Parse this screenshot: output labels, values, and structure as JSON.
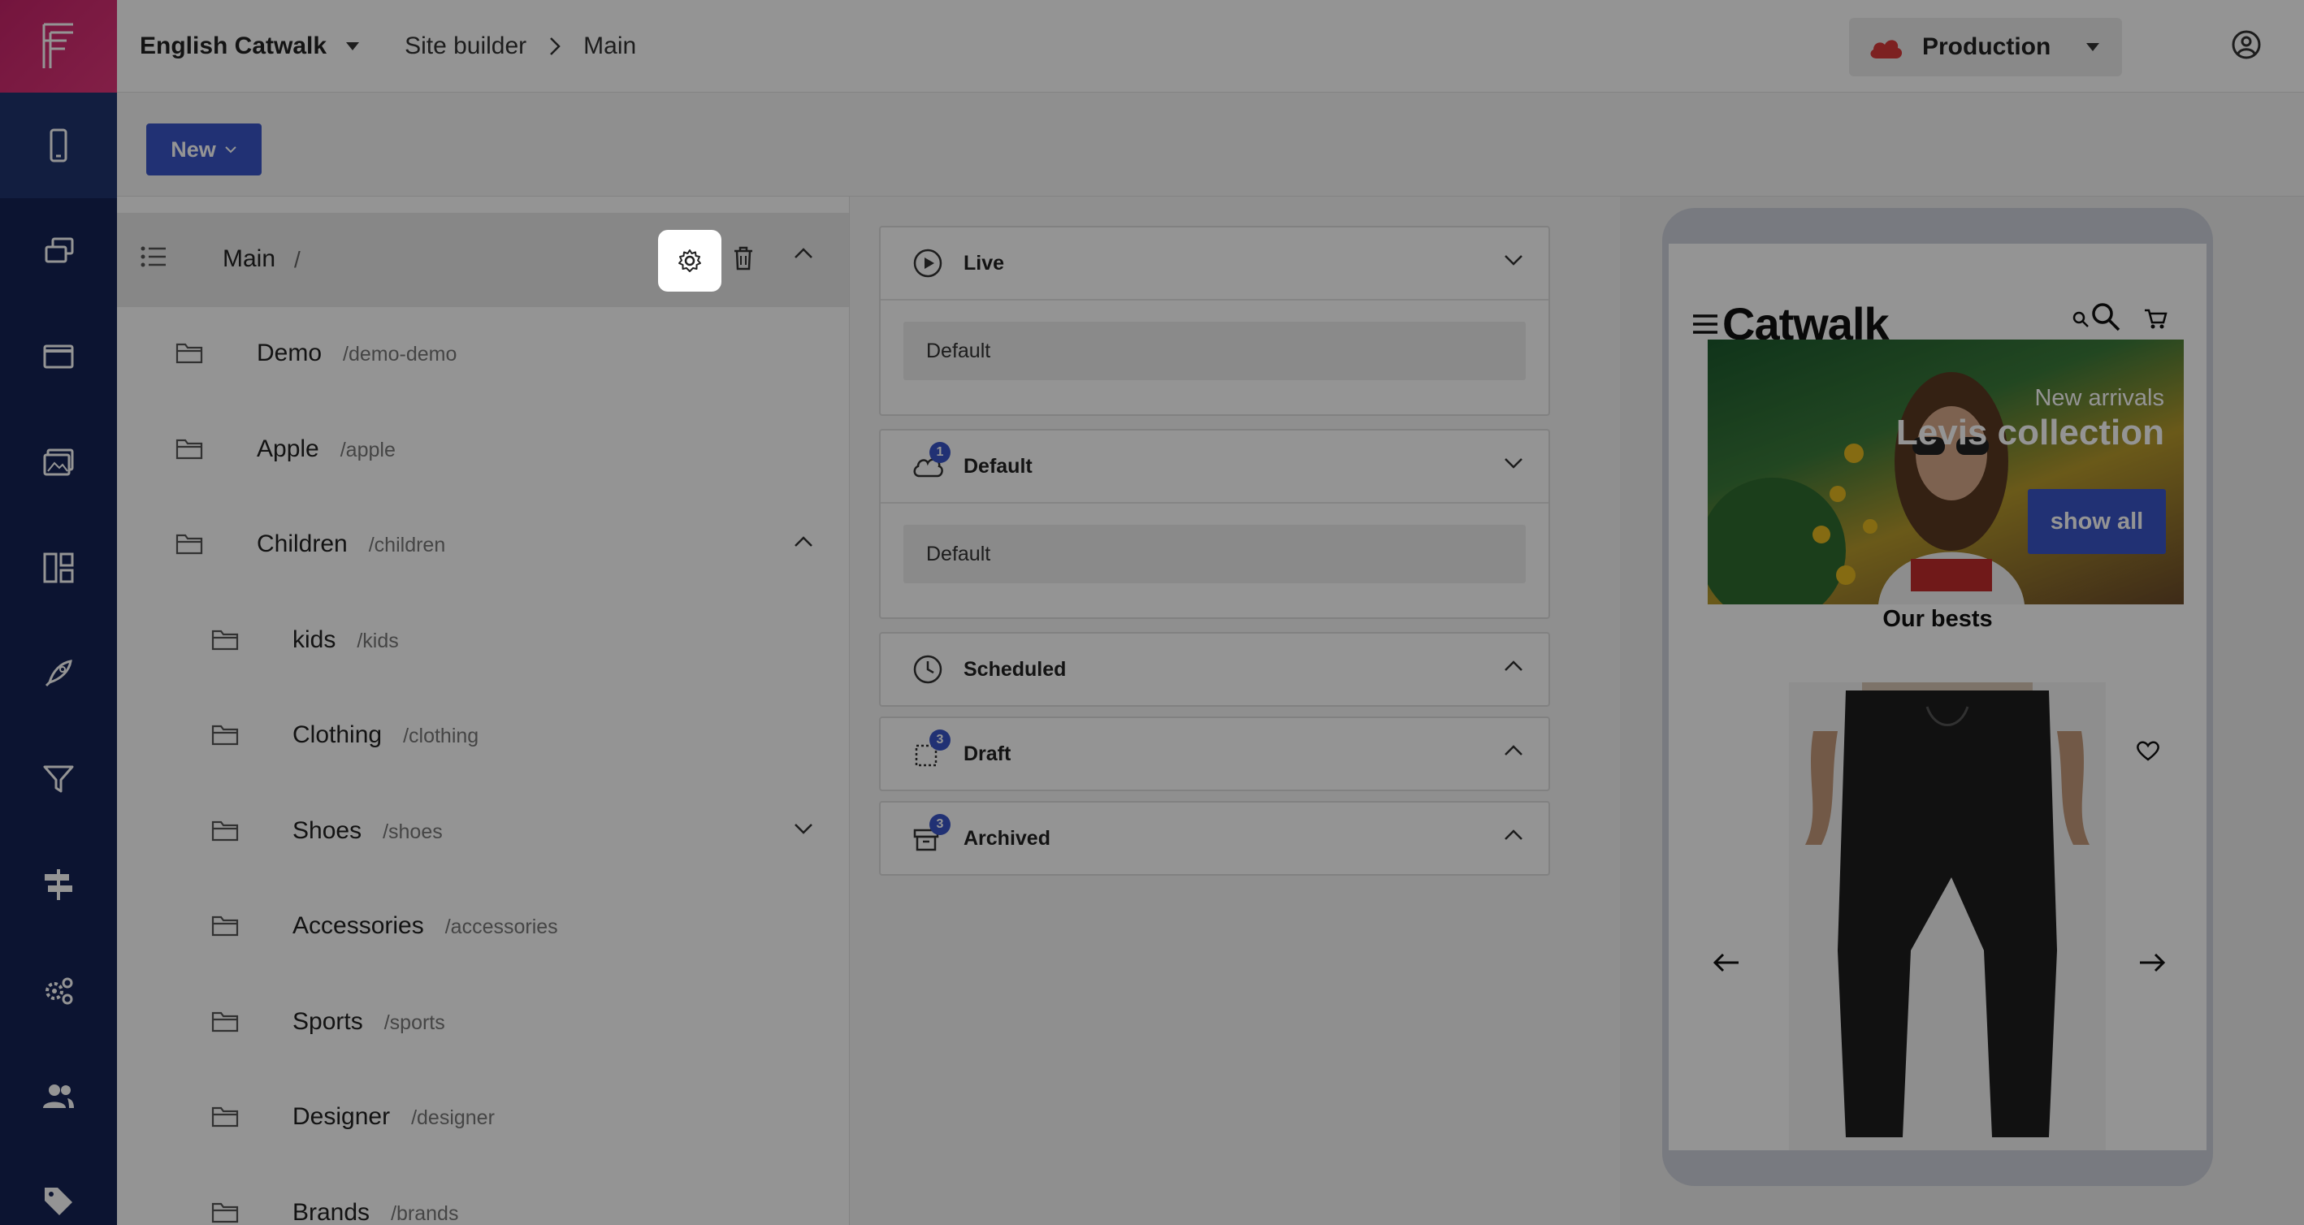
{
  "app": {
    "logo_letter": "F"
  },
  "topbar": {
    "site_name": "English Catwalk",
    "breadcrumb": [
      "Site builder",
      "Main"
    ],
    "environment": "Production"
  },
  "nav": {
    "items": [
      "mobile-icon",
      "pages-icon",
      "window-icon",
      "media-icon",
      "layout-icon",
      "rocket-icon",
      "filter-icon",
      "signpost-icon",
      "settings-icon",
      "users-icon",
      "tag-icon"
    ],
    "active": "mobile-icon"
  },
  "toolbar": {
    "new_label": "New"
  },
  "tree": {
    "root": {
      "name": "Main",
      "path": "/"
    },
    "items": [
      {
        "name": "Demo",
        "path": "/demo-demo",
        "level": 1
      },
      {
        "name": "Apple",
        "path": "/apple",
        "level": 1
      },
      {
        "name": "Children",
        "path": "/children",
        "level": 1,
        "expanded": true
      },
      {
        "name": "kids",
        "path": "/kids",
        "level": 2
      },
      {
        "name": "Clothing",
        "path": "/clothing",
        "level": 2
      },
      {
        "name": "Shoes",
        "path": "/shoes",
        "level": 2,
        "expanded": false
      },
      {
        "name": "Accessories",
        "path": "/accessories",
        "level": 2
      },
      {
        "name": "Sports",
        "path": "/sports",
        "level": 2
      },
      {
        "name": "Designer",
        "path": "/designer",
        "level": 2
      },
      {
        "name": "Brands",
        "path": "/brands",
        "level": 2
      }
    ]
  },
  "versions": {
    "live": {
      "label": "Live",
      "item": "Default"
    },
    "default": {
      "label": "Default",
      "badge": "1",
      "item": "Default"
    },
    "scheduled": {
      "label": "Scheduled"
    },
    "draft": {
      "label": "Draft",
      "badge": "3"
    },
    "archived": {
      "label": "Archived",
      "badge": "3"
    }
  },
  "preview": {
    "brand": "Catwalk",
    "hero_kicker": "New arrivals",
    "hero_title": "Levis collection",
    "hero_button": "show all",
    "section_title": "Our bests"
  },
  "colors": {
    "accent": "#3a55c8",
    "nav_bg": "#162455",
    "brand": "#d42b6f",
    "cloud": "#d83a3a"
  }
}
